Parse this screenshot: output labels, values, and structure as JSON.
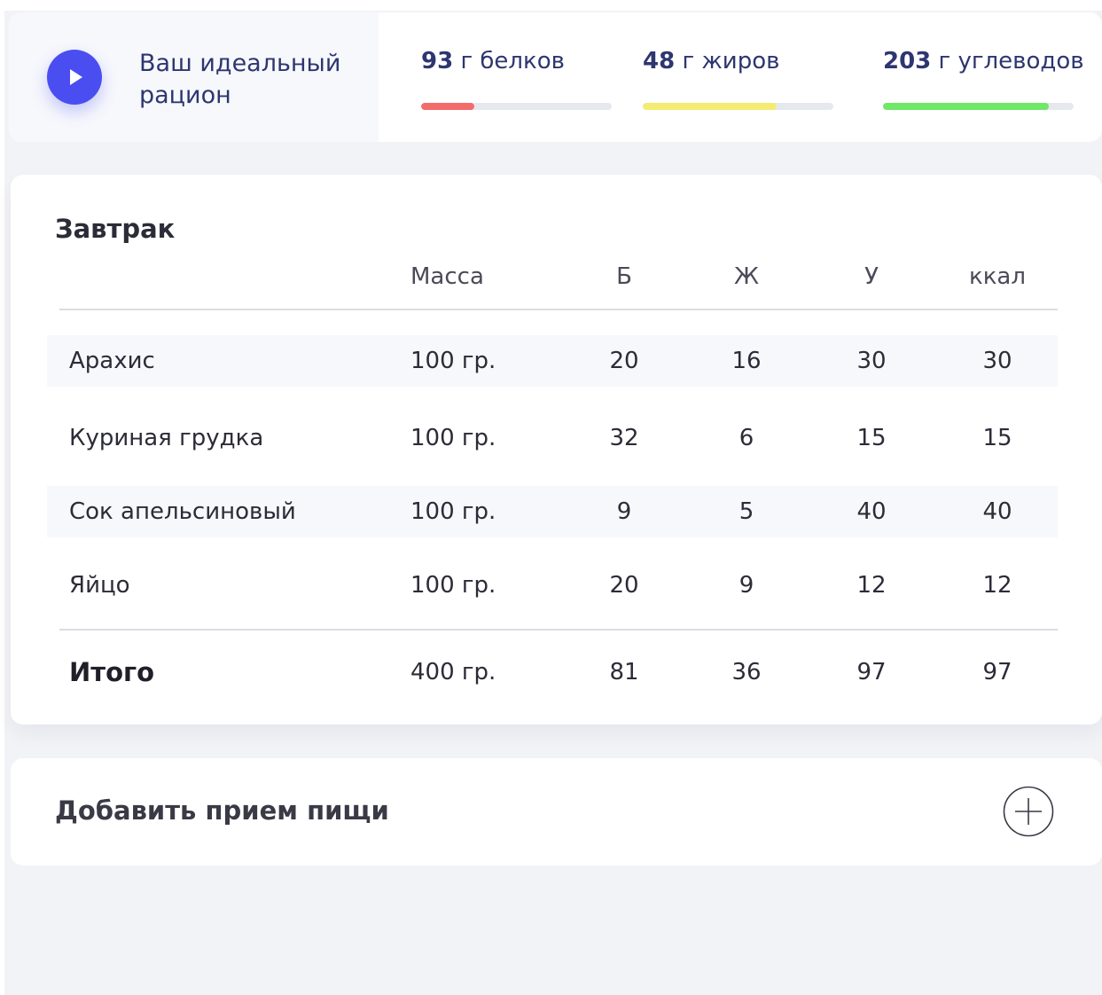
{
  "header": {
    "title": "Ваш идеальный рацион",
    "macros": [
      {
        "number": "93",
        "label": "г белков",
        "progress": 0.28,
        "color": "#f46b6b"
      },
      {
        "number": "48",
        "label": "г жиров",
        "progress": 0.7,
        "color": "#f4ec72"
      },
      {
        "number": "203",
        "label": "г углеводов",
        "progress": 0.87,
        "color": "#6fe868"
      }
    ]
  },
  "meal": {
    "title": "Завтрак",
    "columns": [
      "Масса",
      "Б",
      "Ж",
      "У",
      "ккал"
    ],
    "rows": [
      {
        "name": "Арахис",
        "mass": "100 гр.",
        "b": "20",
        "zh": "16",
        "u": "30",
        "kcal": "30"
      },
      {
        "name": "Куриная грудка",
        "mass": "100 гр.",
        "b": "32",
        "zh": "6",
        "u": "15",
        "kcal": "15"
      },
      {
        "name": "Сок апельсиновый",
        "mass": "100 гр.",
        "b": "9",
        "zh": "5",
        "u": "40",
        "kcal": "40"
      },
      {
        "name": "Яйцо",
        "mass": "100 гр.",
        "b": "20",
        "zh": "9",
        "u": "12",
        "kcal": "12"
      }
    ],
    "total": {
      "name": "Итого",
      "mass": "400 гр.",
      "b": "81",
      "zh": "36",
      "u": "97",
      "kcal": "97"
    }
  },
  "add_meal": {
    "label": "Добавить прием пищи"
  },
  "icons": {
    "play": "play-icon",
    "add": "plus-circle-icon"
  },
  "colors": {
    "accent": "#4a4ef0",
    "title": "#2e3670"
  }
}
